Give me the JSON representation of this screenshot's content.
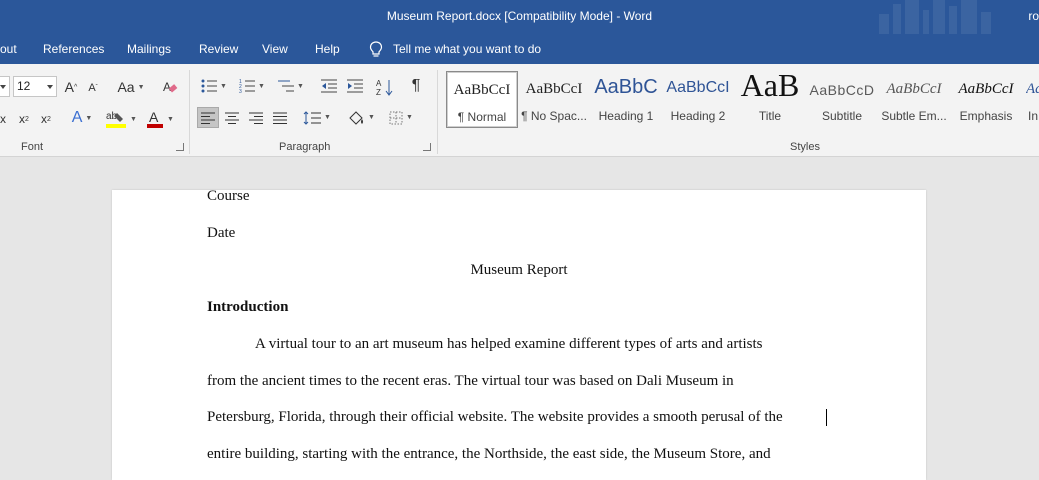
{
  "window": {
    "title": "Museum Report.docx [Compatibility Mode]  -  Word",
    "user": "ro"
  },
  "menu": {
    "tabs": [
      "out",
      "References",
      "Mailings",
      "Review",
      "View",
      "Help"
    ],
    "tell_me": "Tell me what you want to do"
  },
  "ribbon": {
    "font": {
      "size": "12",
      "label": "Font"
    },
    "paragraph": {
      "label": "Paragraph"
    },
    "styles": {
      "label": "Styles",
      "items": [
        {
          "preview": "AaBbCcI",
          "name": "¶ Normal"
        },
        {
          "preview": "AaBbCcI",
          "name": "¶ No Spac..."
        },
        {
          "preview": "AaBbC",
          "name": "Heading 1"
        },
        {
          "preview": "AaBbCcI",
          "name": "Heading 2"
        },
        {
          "preview": "AaB",
          "name": "Title"
        },
        {
          "preview": "AaBbCcD",
          "name": "Subtitle"
        },
        {
          "preview": "AaBbCcI",
          "name": "Subtle Em..."
        },
        {
          "preview": "AaBbCcI",
          "name": "Emphasis"
        },
        {
          "preview": "Aa",
          "name": "In"
        }
      ]
    }
  },
  "document": {
    "lines": [
      "Course",
      "Date",
      "Museum Report",
      "Introduction",
      "A virtual tour to an art museum has helped examine different types of arts and artists",
      "from the ancient times to the recent eras. The virtual tour was based on Dali Museum in",
      "Petersburg, Florida, through their official website. The website provides a smooth perusal of the",
      "entire building, starting with the entrance, the Northside, the east side, the Museum Store, and"
    ]
  },
  "colors": {
    "title_bar": "#2b579a",
    "ribbon": "#f3f3f3",
    "highlight_yellow": "#ffff00",
    "font_red": "#c00000",
    "heading_blue": "#2f5496"
  }
}
